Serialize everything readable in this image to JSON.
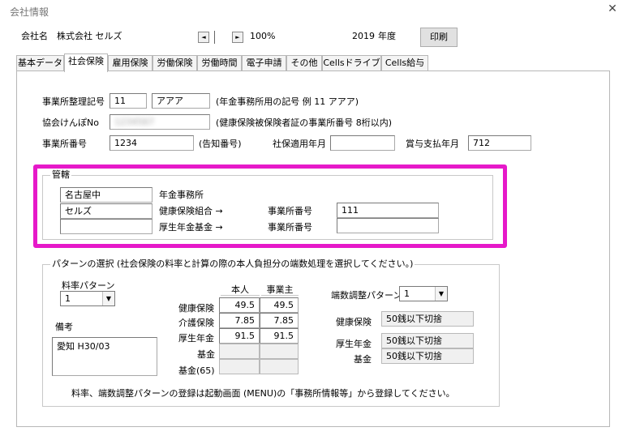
{
  "window": {
    "title": "会社情報",
    "close_glyph": "✕"
  },
  "header": {
    "company_label": "会社名",
    "company_name": "株式会社 セルズ",
    "zoom_prev": "◄",
    "zoom_next": "►",
    "zoom": "100%",
    "year": "2019",
    "year_label": "年度",
    "print_button": "印刷"
  },
  "tabs": [
    {
      "label": "基本データ"
    },
    {
      "label": "社会保険"
    },
    {
      "label": "雇用保険"
    },
    {
      "label": "労働保険"
    },
    {
      "label": "労働時間"
    },
    {
      "label": "電子申請"
    },
    {
      "label": "その他"
    },
    {
      "label": "Cellsドライブ"
    },
    {
      "label": "Cells給与"
    }
  ],
  "active_tab": 1,
  "office": {
    "seiri_label": "事業所整理記号",
    "seiri_code1": "11",
    "seiri_code2": "アアア",
    "seiri_note": "(年金事務所用の記号 例 11 アアア)",
    "kyokai_label": "協会けんぽNo",
    "kyokai_value": "1234567",
    "kyokai_note": "(健康保険被保険者証の事業所番号 8桁以内)",
    "office_no_label": "事業所番号",
    "office_no": "1234",
    "office_no_note": "(告知番号)",
    "shaho_label": "社保適用年月",
    "shaho_value": "",
    "bonus_label": "賞与支払年月",
    "bonus_value": "712"
  },
  "kankatsu": {
    "legend": "管轄",
    "nenkin_office": "名古屋中",
    "nenkin_office_label": "年金事務所",
    "kenpo_kumiai": "セルズ",
    "kenpo_kumiai_label": "健康保険組合 →",
    "kenpo_office_no_label": "事業所番号",
    "kenpo_office_no": "111",
    "kousei_kikin": "",
    "kousei_kikin_label": "厚生年金基金 →",
    "kousei_office_no_label": "事業所番号",
    "kousei_office_no": ""
  },
  "pattern": {
    "legend": "パターンの選択 (社会保険の料率と計算の際の本人負担分の端数処理を選択してください。)",
    "rate_pattern_label": "料率パターン",
    "rate_pattern": "1",
    "remarks_label": "備考",
    "remarks": "愛知 H30/03",
    "col_self": "本人",
    "col_employer": "事業主",
    "rows": [
      {
        "label": "健康保険",
        "self": "49.5",
        "employer": "49.5"
      },
      {
        "label": "介護保険",
        "self": "7.85",
        "employer": "7.85"
      },
      {
        "label": "厚生年金",
        "self": "91.5",
        "employer": "91.5"
      },
      {
        "label": "基金",
        "self": "",
        "employer": ""
      },
      {
        "label": "基金(65)",
        "self": "",
        "employer": ""
      }
    ],
    "rounding_label": "端数調整パターン",
    "rounding_pattern": "1",
    "rounding_rows": [
      {
        "label": "健康保険",
        "value": "50銭以下切捨"
      },
      {
        "label": "厚生年金",
        "value": "50銭以下切捨"
      },
      {
        "label": "基金",
        "value": "50銭以下切捨"
      }
    ],
    "footer_note": "料率、端数調整パターンの登録は起動画面 (MENU)の「事務所情報等」から登録してください。"
  },
  "icons": {
    "dropdown": "▼"
  },
  "colors": {
    "highlight": "#e619c9"
  }
}
